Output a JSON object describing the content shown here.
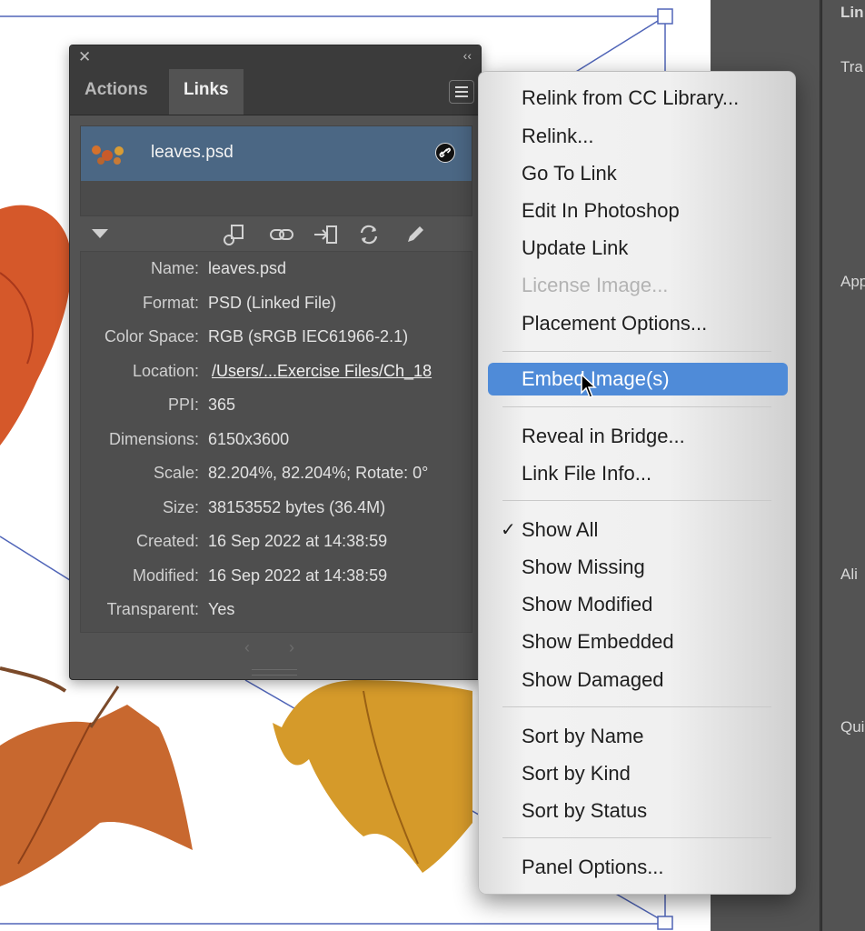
{
  "panel": {
    "close_icon": "✕",
    "collapse_icon": "‹‹",
    "tabs": [
      {
        "label": "Actions"
      },
      {
        "label": "Links"
      }
    ],
    "active_tab": "Links",
    "file": {
      "name": "leaves.psd"
    },
    "info": [
      {
        "key": "Name:",
        "value": "leaves.psd"
      },
      {
        "key": "Format:",
        "value": "PSD (Linked File)"
      },
      {
        "key": "Color Space:",
        "value": "RGB (sRGB IEC61966-2.1)"
      },
      {
        "key": "Location:",
        "value": "/Users/...Exercise Files/Ch_18"
      },
      {
        "key": "PPI:",
        "value": "365"
      },
      {
        "key": "Dimensions:",
        "value": "6150x3600"
      },
      {
        "key": "Scale:",
        "value": "82.204%, 82.204%; Rotate: 0°"
      },
      {
        "key": "Size:",
        "value": "38153552 bytes (36.4M)"
      },
      {
        "key": "Created:",
        "value": "16 Sep 2022 at 14:38:59"
      },
      {
        "key": "Modified:",
        "value": "16 Sep 2022 at 14:38:59"
      },
      {
        "key": "Transparent:",
        "value": "Yes"
      }
    ],
    "pager": {
      "prev": "‹",
      "next": "›"
    }
  },
  "menu": {
    "items": [
      {
        "label": "Relink from CC Library...",
        "state": "normal"
      },
      {
        "label": "Relink...",
        "state": "normal"
      },
      {
        "label": "Go To Link",
        "state": "normal"
      },
      {
        "label": "Edit In Photoshop",
        "state": "normal"
      },
      {
        "label": "Update Link",
        "state": "normal"
      },
      {
        "label": "License Image...",
        "state": "disabled"
      },
      {
        "label": "Placement Options...",
        "state": "normal"
      },
      {
        "label": "Embed Image(s)",
        "state": "highlighted"
      },
      {
        "label": "Reveal in Bridge...",
        "state": "normal"
      },
      {
        "label": "Link File Info...",
        "state": "normal"
      },
      {
        "label": "Show All",
        "state": "checked"
      },
      {
        "label": "Show Missing",
        "state": "normal"
      },
      {
        "label": "Show Modified",
        "state": "normal"
      },
      {
        "label": "Show Embedded",
        "state": "normal"
      },
      {
        "label": "Show Damaged",
        "state": "normal"
      },
      {
        "label": "Sort by Name",
        "state": "normal"
      },
      {
        "label": "Sort by Kind",
        "state": "normal"
      },
      {
        "label": "Sort by Status",
        "state": "normal"
      },
      {
        "label": "Panel Options...",
        "state": "normal"
      }
    ],
    "check_glyph": "✓"
  },
  "properties_panel": {
    "labels": [
      "Lin",
      "Tra",
      "App",
      "Ali",
      "Qui"
    ]
  },
  "colors": {
    "panel_bg": "#535353",
    "selection_row": "#4b6784",
    "menu_highlight": "#4f8bd8",
    "frame_line": "#4a5fb8"
  },
  "icons": [
    "relink-cc-icon",
    "relink-icon",
    "goto-link-icon",
    "update-link-icon",
    "edit-original-icon",
    "linked-file-icon",
    "panel-menu-icon"
  ]
}
